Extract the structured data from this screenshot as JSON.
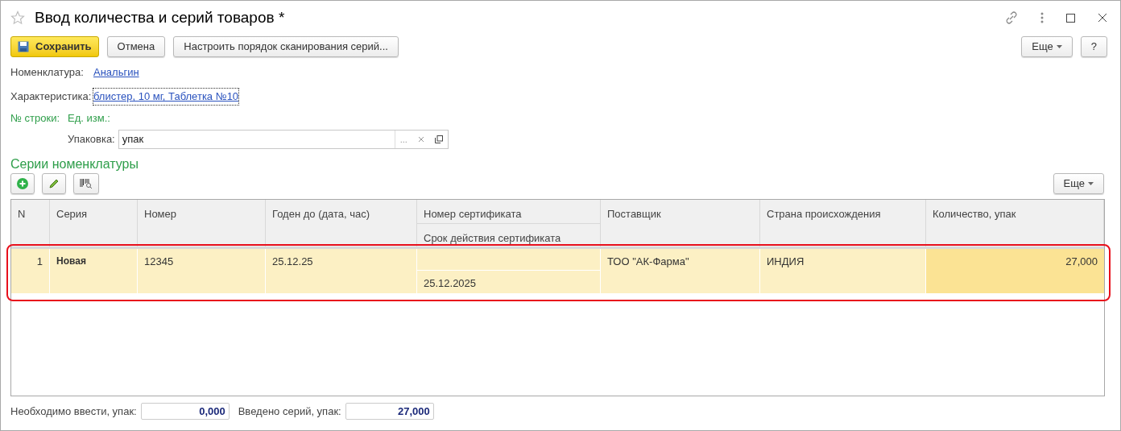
{
  "window": {
    "title": "Ввод количества и серий товаров *"
  },
  "toolbar": {
    "save": "Сохранить",
    "cancel": "Отмена",
    "configure": "Настроить порядок сканирования серий...",
    "more": "Еще",
    "help": "?"
  },
  "fields": {
    "nomenclature_label": "Номенклатура:",
    "nomenclature": "Анальгин",
    "characteristic_label": "Характеристика:",
    "characteristic": "блистер, 10 мг, Таблетка №10",
    "row_label": "№ строки:",
    "unit_label": "Ед. изм.:",
    "packaging_label": "Упаковка:",
    "packaging": "упак",
    "packaging_dots": "..."
  },
  "series": {
    "title": "Серии номенклатуры",
    "more": "Еще",
    "columns": [
      "N",
      "Серия",
      "Номер",
      "Годен до (дата, час)",
      "Номер сертификата",
      "Срок действия сертификата",
      "Поставщик",
      "Страна происхождения",
      "Количество, упак"
    ],
    "rows": [
      {
        "n": "1",
        "series": "Новая",
        "number": "12345",
        "expiry": "25.12.25",
        "cert_number": "",
        "cert_valid": "25.12.2025",
        "supplier": "ТОО \"АК-Фарма\"",
        "country": "ИНДИЯ",
        "quantity": "27,000",
        "selected": true,
        "highlighted": true
      }
    ]
  },
  "footer": {
    "required_label": "Необходимо ввести, упак:",
    "required": "0,000",
    "entered_label": "Введено серий, упак:",
    "entered": "27,000"
  }
}
